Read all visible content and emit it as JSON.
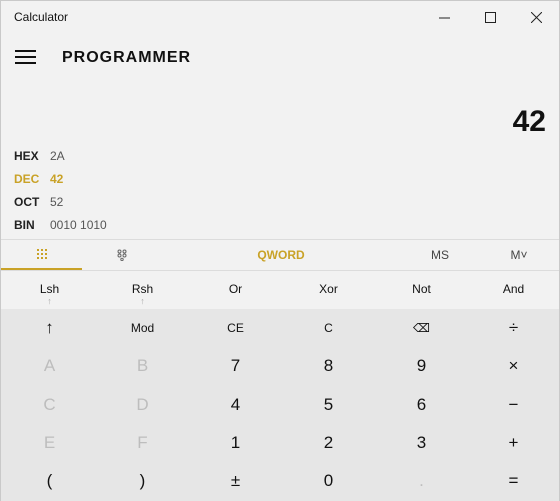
{
  "window": {
    "title": "Calculator"
  },
  "header": {
    "mode": "PROGRAMMER"
  },
  "display": {
    "value": "42"
  },
  "radix": [
    {
      "key": "HEX",
      "value": "2A",
      "active": false
    },
    {
      "key": "DEC",
      "value": "42",
      "active": true
    },
    {
      "key": "OCT",
      "value": "52",
      "active": false
    },
    {
      "key": "BIN",
      "value": "0010 1010",
      "active": false
    }
  ],
  "tabs": {
    "word": "QWORD",
    "ms": "MS",
    "mlist": "M˅"
  },
  "bitwise": [
    {
      "label": "Lsh",
      "sub": "↑"
    },
    {
      "label": "Rsh",
      "sub": "↑"
    },
    {
      "label": "Or",
      "sub": ""
    },
    {
      "label": "Xor",
      "sub": ""
    },
    {
      "label": "Not",
      "sub": ""
    },
    {
      "label": "And",
      "sub": ""
    }
  ],
  "keys": [
    [
      "↑",
      "Mod",
      "CE",
      "C",
      "⌫",
      "÷"
    ],
    [
      "A",
      "B",
      "7",
      "8",
      "9",
      "×"
    ],
    [
      "C",
      "D",
      "4",
      "5",
      "6",
      "−"
    ],
    [
      "E",
      "F",
      "1",
      "2",
      "3",
      "+"
    ],
    [
      "(",
      ")",
      "±",
      "0",
      ".",
      "="
    ]
  ],
  "colors": {
    "accent": "#c9a227",
    "background": "#f2f2f2",
    "keypad": "#e6e6e6",
    "disabled": "#bdbdbd"
  }
}
